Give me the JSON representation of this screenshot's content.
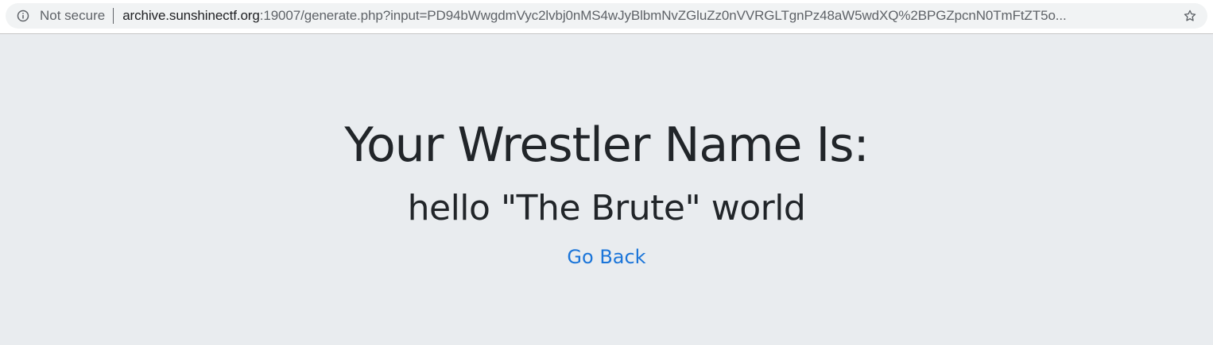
{
  "browser": {
    "security_label": "Not secure",
    "url_host": "archive.sunshinectf.org",
    "url_rest": ":19007/generate.php?input=PD94bWwgdmVyc2lvbj0nMS4wJyBlbmNvZGluZz0nVVRGLTgnPz48aW5wdXQ%2BPGZpcnN0TmFtZT5o...",
    "icons": {
      "info": "info-icon",
      "bookmark": "star-icon"
    }
  },
  "page": {
    "heading": "Your Wrestler Name Is:",
    "wrestler_name": "hello \"The Brute\" world",
    "go_back_label": "Go Back",
    "colors": {
      "background": "#e9ecef",
      "text": "#212529",
      "link": "#1b75d9"
    }
  }
}
